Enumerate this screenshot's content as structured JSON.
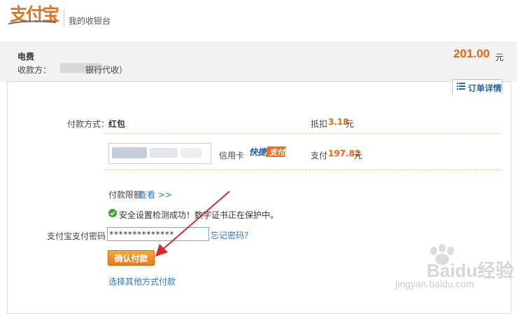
{
  "header": {
    "logo_text": "支付宝",
    "title": "我的收银台"
  },
  "order": {
    "name": "电费",
    "payee_label": "收款方：",
    "payee_suffix": "银行代收）",
    "amount": "201.00",
    "unit": "元"
  },
  "order_detail": {
    "label": "订单详情"
  },
  "payment": {
    "method_label": "付款方式：",
    "method_value": "红包",
    "deduct_label": "抵扣",
    "deduct_amount": "3.18",
    "deduct_unit": "元",
    "card_type": "信用卡",
    "express_badge": "快捷支付",
    "pay_label": "支付",
    "pay_amount": "197.82",
    "pay_unit": "元",
    "limit_label": "付款限额",
    "limit_link": "查看 >>",
    "security_message": "安全设置检测成功！数字证书正在保护中。",
    "password_label": "支付宝支付密码：",
    "password_value": "**************",
    "forgot_link": "忘记密码?",
    "confirm_button": "确认付款",
    "other_method_link": "选择其他方式付款"
  },
  "watermark": {
    "text": "Baidu经验",
    "url": "jingyan.baidu.com"
  },
  "colors": {
    "brand_orange": "#e8721c",
    "amount_orange": "#e8650e",
    "link_blue": "#2a7ac8",
    "arrow_red": "#d62a2a",
    "success_green": "#3aa63a"
  }
}
